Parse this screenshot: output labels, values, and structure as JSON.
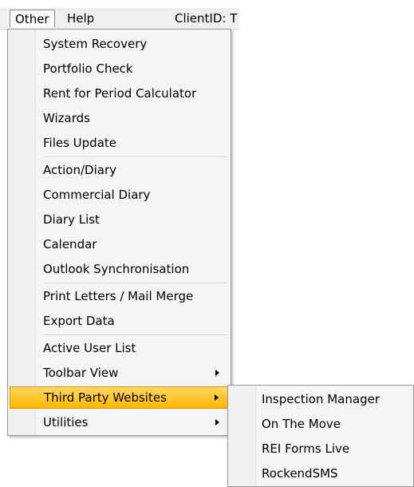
{
  "menubar": {
    "items": [
      {
        "label": "Other"
      },
      {
        "label": "Help"
      }
    ],
    "client_id": "ClientID: T"
  },
  "menu": {
    "items": [
      {
        "label": "System Recovery"
      },
      {
        "label": "Portfolio Check"
      },
      {
        "label": "Rent for Period Calculator"
      },
      {
        "label": "Wizards"
      },
      {
        "label": "Files Update"
      },
      {
        "label": "Action/Diary"
      },
      {
        "label": "Commercial Diary"
      },
      {
        "label": "Diary List"
      },
      {
        "label": "Calendar"
      },
      {
        "label": "Outlook Synchronisation"
      },
      {
        "label": "Print Letters / Mail Merge"
      },
      {
        "label": "Export Data"
      },
      {
        "label": "Active User List"
      },
      {
        "label": "Toolbar View"
      },
      {
        "label": "Third Party Websites"
      },
      {
        "label": "Utilities"
      }
    ]
  },
  "submenu": {
    "items": [
      {
        "label": "Inspection Manager"
      },
      {
        "label": "On The Move"
      },
      {
        "label": "REI Forms Live"
      },
      {
        "label": "RockendSMS"
      }
    ]
  },
  "colors": {
    "highlight": "#ffc52e",
    "menu_bg": "#f5f5f5",
    "border": "#979797"
  }
}
